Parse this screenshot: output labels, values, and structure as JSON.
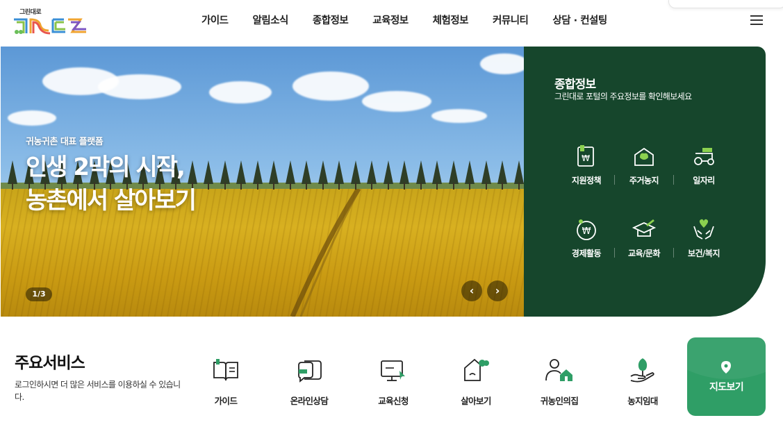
{
  "header": {
    "logo_text": "그린대로",
    "nav": [
      "가이드",
      "알림소식",
      "종합정보",
      "교육정보",
      "체험정보",
      "커뮤니티",
      "상담 · 컨설팅"
    ]
  },
  "hero": {
    "subtitle": "귀농귀촌 대표 플랫폼",
    "title_line1": "인생 2막의 시작,",
    "title_line2": "농촌에서 살아보기",
    "pager": "1/3",
    "prev_icon": "‹",
    "next_icon": "›"
  },
  "info_panel": {
    "title": "종합정보",
    "description": "그린대로 포털의 주요정보를 확인해보세요",
    "categories": [
      {
        "label": "지원정책",
        "icon": "won-document-icon"
      },
      {
        "label": "주거농지",
        "icon": "house-leaf-icon"
      },
      {
        "label": "일자리",
        "icon": "tractor-icon"
      },
      {
        "label": "경제활동",
        "icon": "won-coin-icon"
      },
      {
        "label": "교육/문화",
        "icon": "graduation-cap-icon"
      },
      {
        "label": "보건/복지",
        "icon": "heart-hands-icon"
      }
    ],
    "accent_color": "#8bd14f",
    "background_color": "#16462c"
  },
  "services": {
    "heading": "주요서비스",
    "description": "로그인하시면 더 많은 서비스를 이용하실 수 있습니다.",
    "items": [
      {
        "label": "가이드",
        "icon": "book-icon"
      },
      {
        "label": "온라인상담",
        "icon": "chat-bubble-icon"
      },
      {
        "label": "교육신청",
        "icon": "monitor-icon"
      },
      {
        "label": "살아보기",
        "icon": "home-icon"
      },
      {
        "label": "귀농인의집",
        "icon": "person-house-icon"
      },
      {
        "label": "농지임대",
        "icon": "hand-tree-icon"
      }
    ],
    "accent_color": "#2f9e66",
    "map_button": "지도보기"
  }
}
